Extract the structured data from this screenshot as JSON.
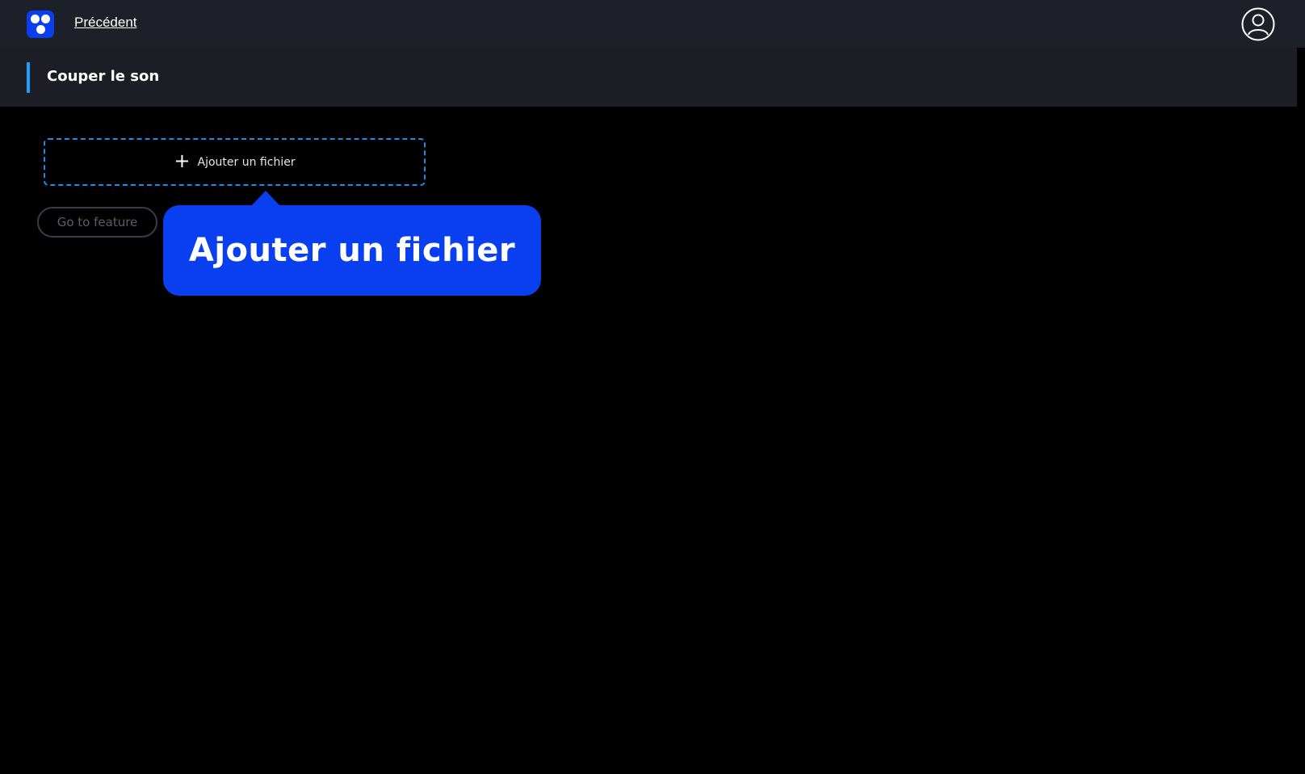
{
  "topbar": {
    "back_label": "Précédent",
    "logo_icon": "app-logo-icon",
    "avatar_icon": "user-account-icon"
  },
  "subheader": {
    "title": "Couper le son"
  },
  "dropzone": {
    "label": "Ajouter un fichier",
    "icon": "plus-icon"
  },
  "go_button": {
    "label": "Go to feature"
  },
  "tooltip": {
    "text": "Ajouter un fichier"
  },
  "colors": {
    "brand": "#0a3ff0",
    "accent": "#1aa0ff",
    "topbar_bg": "#1e2029",
    "page_bg": "#000000"
  }
}
